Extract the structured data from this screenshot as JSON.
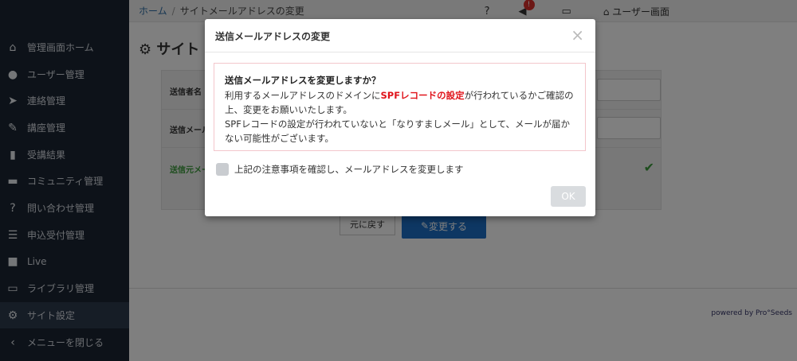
{
  "breadcrumb": {
    "home": "ホーム",
    "separator": "/",
    "current": "サイトメールアドレスの変更"
  },
  "topbar": {
    "notification_count": "!",
    "user_screen": "ユーザー画面"
  },
  "sidebar": {
    "items": [
      {
        "label": "管理画面ホーム",
        "icon": "home-icon",
        "glyph": "⌂"
      },
      {
        "label": "ユーザー管理",
        "icon": "user-icon",
        "glyph": "●"
      },
      {
        "label": "連絡管理",
        "icon": "send-icon",
        "glyph": "➤"
      },
      {
        "label": "講座管理",
        "icon": "pencil-icon",
        "glyph": "✎"
      },
      {
        "label": "受講結果",
        "icon": "bar-chart-icon",
        "glyph": "▮"
      },
      {
        "label": "コミュニティ管理",
        "icon": "comment-icon",
        "glyph": "▬"
      },
      {
        "label": "問い合わせ管理",
        "icon": "question-icon",
        "glyph": "?"
      },
      {
        "label": "申込受付管理",
        "icon": "list-icon",
        "glyph": "☰"
      },
      {
        "label": "Live",
        "icon": "video-icon",
        "glyph": "■"
      },
      {
        "label": "ライブラリ管理",
        "icon": "folder-icon",
        "glyph": "▭"
      },
      {
        "label": "サイト設定",
        "icon": "gear-icon",
        "glyph": "⚙"
      },
      {
        "label": "メニューを閉じる",
        "icon": "chevron-left-icon",
        "glyph": "‹"
      }
    ],
    "active_index": 10
  },
  "page": {
    "title": "サイト",
    "form_labels": [
      "送信者名",
      "送信メール",
      "送信元メー"
    ],
    "back_button": "元に戻す",
    "change_button": "変更する",
    "powered_by": "powered by Pro°Seeds"
  },
  "modal": {
    "title": "送信メールアドレスの変更",
    "close": "×",
    "alert_heading": "送信メールアドレスを変更しますか？",
    "alert_line1_before": "利用するメールアドレスのドメインに",
    "alert_spf": "SPFレコードの設定",
    "alert_line1_after": "が行われているかご確認の",
    "alert_line2": "上、変更をお願いいたします。",
    "alert_line3": "SPFレコードの設定が行われていないと「なりすましメール」として、メールが届か",
    "alert_line4": "ない可能性がございます。",
    "confirm_label": "上記の注意事項を確認し、メールアドレスを変更します",
    "ok_button": "OK"
  },
  "colors": {
    "spf_highlight": "#e0141b",
    "sidebar_bg": "#1b2532",
    "primary_button": "#1c6fc6"
  }
}
